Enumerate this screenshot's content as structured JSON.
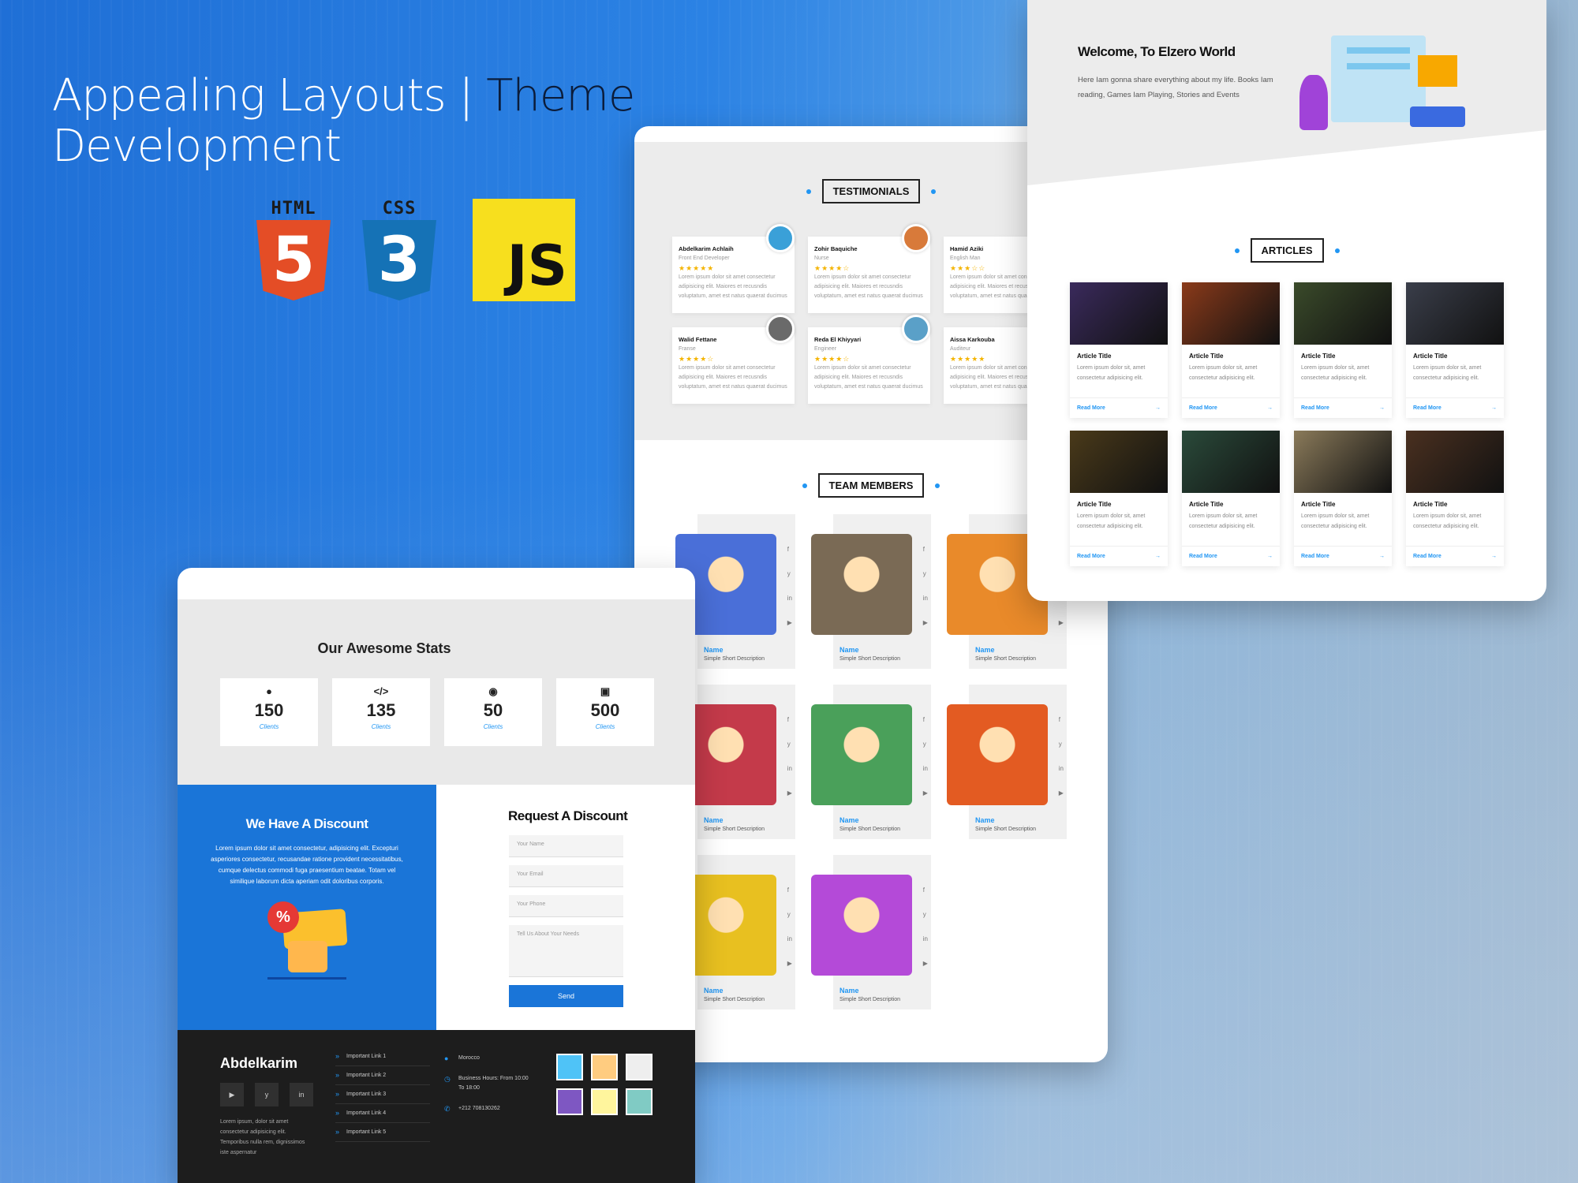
{
  "headline": {
    "line1_a": "Appealing Layouts",
    "line1_sep": " | ",
    "line1_b": "Theme",
    "line2": "Development"
  },
  "tech": {
    "html": "HTML",
    "html_glyph": "5",
    "css": "CSS",
    "css_glyph": "3",
    "js": "JS"
  },
  "center": {
    "testimonials_title": "TESTIMONIALS",
    "testimonials": [
      {
        "name": "Abdelkarim Achlaih",
        "role": "Front End Developer",
        "stars": "★★★★★",
        "text": "Lorem ipsum dolor sit amet consectetur adipisicing elit. Maiores et recusndis voluptatum, amet est natus quaerat ducimus"
      },
      {
        "name": "Zohir Baquiche",
        "role": "Nurse",
        "stars": "★★★★☆",
        "text": "Lorem ipsum dolor sit amet consectetur adipisicing elit. Maiores et recusndis voluptatum, amet est natus quaerat ducimus"
      },
      {
        "name": "Hamid Aziki",
        "role": "English Man",
        "stars": "★★★☆☆",
        "text": "Lorem ipsum dolor sit amet consectetur adipisicing elit. Maiores et recusndis voluptatum, amet est natus quaerat ducimus"
      },
      {
        "name": "Walid Fettane",
        "role": "Franse",
        "stars": "★★★★☆",
        "text": "Lorem ipsum dolor sit amet consectetur adipisicing elit. Maiores et recusndis voluptatum, amet est natus quaerat ducimus"
      },
      {
        "name": "Reda El Khiyyari",
        "role": "Engineer",
        "stars": "★★★★☆",
        "text": "Lorem ipsum dolor sit amet consectetur adipisicing elit. Maiores et recusndis voluptatum, amet est natus quaerat ducimus"
      },
      {
        "name": "Aissa Karkouba",
        "role": "Auditeur",
        "stars": "★★★★★",
        "text": "Lorem ipsum dolor sit amet consectetur adipisicing elit. Maiores et recusndis voluptatum, amet est natus quaerat ducimus"
      }
    ],
    "team_title": "TEAM MEMBERS",
    "members": [
      {
        "name": "Name",
        "desc": "Simple Short Description",
        "color": "#4a6fd8"
      },
      {
        "name": "Name",
        "desc": "Simple Short Description",
        "color": "#7a6a55"
      },
      {
        "name": "Name",
        "desc": "Simple Short Description",
        "color": "#e98a2a"
      },
      {
        "name": "Name",
        "desc": "Simple Short Description",
        "color": "#c43a4a"
      },
      {
        "name": "Name",
        "desc": "Simple Short Description",
        "color": "#4aa05a"
      },
      {
        "name": "Name",
        "desc": "Simple Short Description",
        "color": "#e35b22"
      },
      {
        "name": "Name",
        "desc": "Simple Short Description",
        "color": "#e8c020"
      },
      {
        "name": "Name",
        "desc": "Simple Short Description",
        "color": "#b44ad8"
      }
    ],
    "social": [
      "f",
      "y",
      "in",
      "▶"
    ]
  },
  "right": {
    "welcome": "Welcome, To Elzero World",
    "intro": "Here Iam gonna share everything about my life. Books Iam reading, Games Iam Playing, Stories and Events",
    "articles_title": "ARTICLES",
    "articles": [
      {
        "title": "Article Title",
        "desc": "Lorem ipsum dolor sit, amet consectetur adipisicing elit.",
        "more": "Read More",
        "color": "#3a2a5c"
      },
      {
        "title": "Article Title",
        "desc": "Lorem ipsum dolor sit, amet consectetur adipisicing elit.",
        "more": "Read More",
        "color": "#8a3a1a"
      },
      {
        "title": "Article Title",
        "desc": "Lorem ipsum dolor sit, amet consectetur adipisicing elit.",
        "more": "Read More",
        "color": "#3a4a2a"
      },
      {
        "title": "Article Title",
        "desc": "Lorem ipsum dolor sit, amet consectetur adipisicing elit.",
        "more": "Read More",
        "color": "#3a3e4a"
      },
      {
        "title": "Article Title",
        "desc": "Lorem ipsum dolor sit, amet consectetur adipisicing elit.",
        "more": "Read More",
        "color": "#4a3a1a"
      },
      {
        "title": "Article Title",
        "desc": "Lorem ipsum dolor sit, amet consectetur adipisicing elit.",
        "more": "Read More",
        "color": "#2a4a3a"
      },
      {
        "title": "Article Title",
        "desc": "Lorem ipsum dolor sit, amet consectetur adipisicing elit.",
        "more": "Read More",
        "color": "#8a7a5a"
      },
      {
        "title": "Article Title",
        "desc": "Lorem ipsum dolor sit, amet consectetur adipisicing elit.",
        "more": "Read More",
        "color": "#4a3020"
      }
    ]
  },
  "left": {
    "stats_title": "Our Awesome Stats",
    "stats": [
      {
        "icon": "user-icon",
        "glyph": "●",
        "num": "150",
        "label": "Clients"
      },
      {
        "icon": "code-icon",
        "glyph": "</>",
        "num": "135",
        "label": "Clients"
      },
      {
        "icon": "globe-icon",
        "glyph": "◉",
        "num": "50",
        "label": "Clients"
      },
      {
        "icon": "money-icon",
        "glyph": "▣",
        "num": "500",
        "label": "Clients"
      }
    ],
    "discount_title": "We Have A Discount",
    "discount_text": "Lorem ipsum dolor sit amet consectetur, adipisicing elit. Excepturi asperiores consectetur, recusandae ratione provident necessitatibus, cumque delectus commodi fuga praesentium beatae. Totam vel similique laborum dicta aperiam odit doloribus corporis.",
    "request_title": "Request A Discount",
    "fields": {
      "name": "Your Name",
      "email": "Your Email",
      "phone": "Your Phone",
      "needs": "Tell Us About Your Needs"
    },
    "send": "Send",
    "footer": {
      "brand": "Abdelkarim",
      "social": [
        "▶",
        "y",
        "in"
      ],
      "desc": "Lorem ipsum, dolor sit amet consectetur adipisicing elit. Temporibus nulla rem, dignissimos iste aspernatur",
      "links": [
        "Important Link 1",
        "Important Link 2",
        "Important Link 3",
        "Important Link 4",
        "Important Link 5"
      ],
      "location": "Morocco",
      "hours": "Business Hours: From 10:00 To 18:00",
      "phone": "+212 708130262"
    }
  }
}
